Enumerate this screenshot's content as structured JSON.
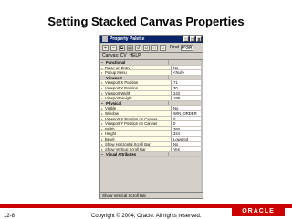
{
  "slide": {
    "title": "Setting Stacked Canvas Properties",
    "page_number": "12-8",
    "copyright": "Copyright © 2004, Oracle.  All rights reserved.",
    "logo_text": "ORACLE"
  },
  "palette": {
    "window_title": "Property Palette",
    "find_label": "Find",
    "find_value": "PGR",
    "context": "Canvas: CV_HELP",
    "status_text": "Show Vertical Scroll Bar",
    "window_buttons": [
      "_",
      "□",
      "x"
    ],
    "rows": [
      {
        "type": "section",
        "name": "Functional",
        "value": ""
      },
      {
        "type": "prop",
        "name": "Raise on Entry",
        "value": "No"
      },
      {
        "type": "prop",
        "name": "Popup Menu",
        "value": "<Null>"
      },
      {
        "type": "section",
        "name": "Viewport",
        "value": ""
      },
      {
        "type": "prop",
        "name": "Viewport X Position",
        "value": "71"
      },
      {
        "type": "prop",
        "name": "Viewport Y Position",
        "value": "30"
      },
      {
        "type": "prop",
        "name": "Viewport Width",
        "value": "243"
      },
      {
        "type": "prop",
        "name": "Viewport Height",
        "value": "198"
      },
      {
        "type": "section",
        "name": "Physical",
        "value": ""
      },
      {
        "type": "prop",
        "name": "Visible",
        "value": "No"
      },
      {
        "type": "prop",
        "name": "Window",
        "value": "WIN_ORDER"
      },
      {
        "type": "prop",
        "name": "Viewport X Position on Canvas",
        "value": "0"
      },
      {
        "type": "prop",
        "name": "Viewport Y Position on Canvas",
        "value": "0"
      },
      {
        "type": "prop",
        "name": "Width",
        "value": "360"
      },
      {
        "type": "prop",
        "name": "Height",
        "value": "324"
      },
      {
        "type": "prop",
        "name": "Bevel",
        "value": "Lowered"
      },
      {
        "type": "prop",
        "name": "Show Horizontal Scroll Bar",
        "value": "No"
      },
      {
        "type": "prop",
        "name": "Show Vertical Scroll Bar",
        "value": "Yes"
      },
      {
        "type": "section",
        "name": "Visual Attributes",
        "value": ""
      }
    ]
  }
}
